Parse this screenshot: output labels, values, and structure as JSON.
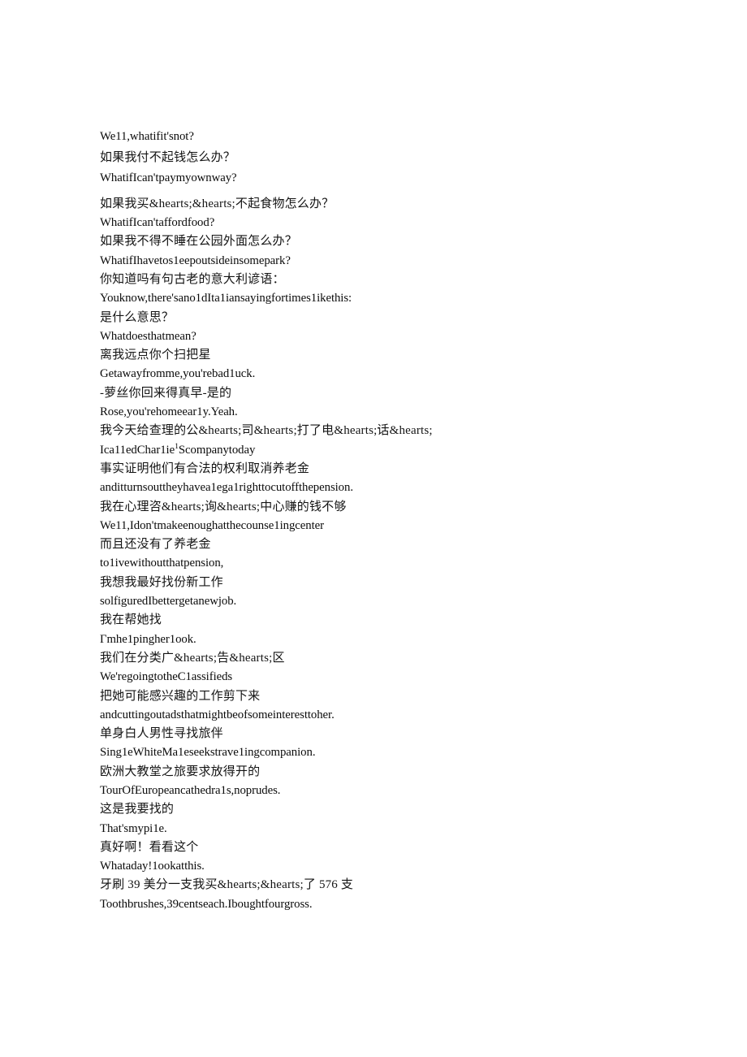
{
  "document": {
    "type": "bilingual-subtitle-transcript",
    "background_color": "#ffffff",
    "text_color": "#0b0b0b",
    "lines": [
      {
        "id": "l1",
        "lang": "en",
        "text": "We11,whatifit'snot?"
      },
      {
        "id": "l2",
        "lang": "zh",
        "text": "如果我付不起钱怎么办？"
      },
      {
        "id": "l3",
        "lang": "en",
        "text": "WhatifIcan'tpaymyownway?"
      },
      {
        "id": "l4",
        "lang": "zh",
        "text": "如果我买&hearts;&hearts;不起食物怎么办？"
      },
      {
        "id": "l5",
        "lang": "en",
        "text": "WhatifIcan'taffordfood?"
      },
      {
        "id": "l6",
        "lang": "zh",
        "text": "如果我不得不睡在公园外面怎么办？"
      },
      {
        "id": "l7",
        "lang": "en",
        "text": "WhatifIhavetos1eepoutsideinsomepark?"
      },
      {
        "id": "l8",
        "lang": "zh",
        "text": "你知道吗有句古老的意大利谚语："
      },
      {
        "id": "l9",
        "lang": "en",
        "text": "Youknow,there'sano1dIta1iansayingfortimes1ikethis:"
      },
      {
        "id": "l10",
        "lang": "zh",
        "text": "是什么意思？"
      },
      {
        "id": "l11",
        "lang": "en",
        "text": "Whatdoesthatmean?"
      },
      {
        "id": "l12",
        "lang": "zh",
        "text": "离我远点你个扫把星"
      },
      {
        "id": "l13",
        "lang": "en",
        "text": "Getawayfromme,you'rebad1uck."
      },
      {
        "id": "l14",
        "lang": "zh",
        "text": "-萝丝你回来得真早-是的"
      },
      {
        "id": "l15",
        "lang": "en",
        "text": "Rose,you'rehomeear1y.Yeah."
      },
      {
        "id": "l16",
        "lang": "zh",
        "text": "我今天给查理的公&hearts;司&hearts;打了电&hearts;话&hearts;"
      },
      {
        "id": "l17",
        "lang": "en",
        "text": "Ica11edChar1ie",
        "sup": "1",
        "text_after": "Scompanytoday"
      },
      {
        "id": "l18",
        "lang": "zh",
        "text": "事实证明他们有合法的权利取消养老金"
      },
      {
        "id": "l19",
        "lang": "en",
        "text": "anditturnsouttheyhavea1ega1righttocutoffthepension."
      },
      {
        "id": "l20",
        "lang": "zh",
        "text": "我在心理咨&hearts;询&hearts;中心赚的钱不够"
      },
      {
        "id": "l21",
        "lang": "en",
        "text": "We11,Idon'tmakeenoughatthecounse1ingcenter"
      },
      {
        "id": "l22",
        "lang": "zh",
        "text": "而且还没有了养老金"
      },
      {
        "id": "l23",
        "lang": "en",
        "text": "to1ivewithoutthatpension,"
      },
      {
        "id": "l24",
        "lang": "zh",
        "text": "我想我最好找份新工作"
      },
      {
        "id": "l25",
        "lang": "en",
        "text": "solfiguredIbettergetanewjob."
      },
      {
        "id": "l26",
        "lang": "zh",
        "text": "我在帮她找"
      },
      {
        "id": "l27",
        "lang": "en",
        "text": "Γmhe1pingher1ook."
      },
      {
        "id": "l28",
        "lang": "zh",
        "text": "我们在分类广&hearts;告&hearts;区"
      },
      {
        "id": "l29",
        "lang": "en",
        "text": "We'regoingtotheC1assifieds"
      },
      {
        "id": "l30",
        "lang": "zh",
        "text": "把她可能感兴趣的工作剪下来"
      },
      {
        "id": "l31",
        "lang": "en",
        "text": "andcuttingoutadsthatmightbeofsomeinteresttoher."
      },
      {
        "id": "l32",
        "lang": "zh",
        "text": "单身白人男性寻找旅伴"
      },
      {
        "id": "l33",
        "lang": "en",
        "text": "Sing1eWhiteMa1eseekstrave1ingcompanion."
      },
      {
        "id": "l34",
        "lang": "zh",
        "text": "欧洲大教堂之旅要求放得开的"
      },
      {
        "id": "l35",
        "lang": "en",
        "text": "TourOfEuropeancathedra1s,noprudes."
      },
      {
        "id": "l36",
        "lang": "zh",
        "text": "这是我要找的"
      },
      {
        "id": "l37",
        "lang": "en",
        "text": "That'smypi1e."
      },
      {
        "id": "l38",
        "lang": "zh",
        "text": "真好啊！看看这个"
      },
      {
        "id": "l39",
        "lang": "en",
        "text": "Whataday!1ookatthis."
      },
      {
        "id": "l40",
        "lang": "zh",
        "text": "牙刷 39 美分一支我买&hearts;&hearts;了 576 支"
      },
      {
        "id": "l41",
        "lang": "en",
        "text": "Toothbrushes,39centseach.Iboughtfourgross."
      }
    ]
  }
}
